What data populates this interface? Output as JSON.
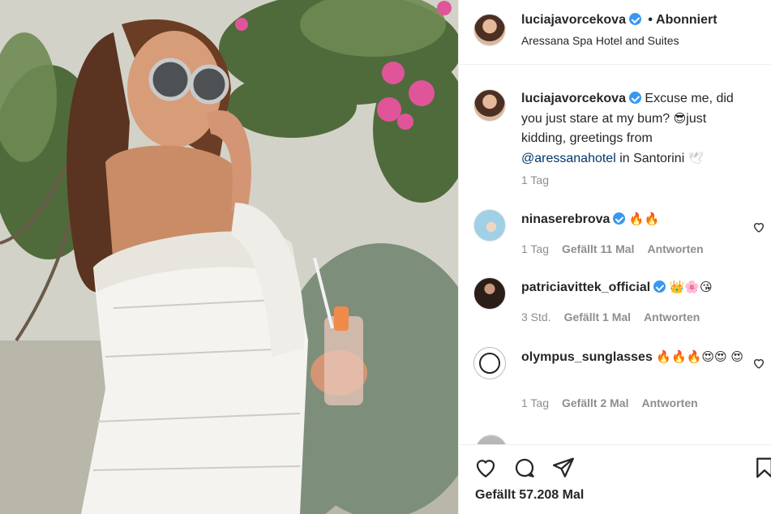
{
  "post": {
    "author": "luciajavorcekova",
    "follow_status": "Abonniert",
    "separator": "•",
    "location": "Aressana Spa Hotel and Suites",
    "caption": {
      "author": "luciajavorcekova",
      "text_before": "Excuse me, did you just stare at my bum? ",
      "emoji_1": "😎",
      "text_middle": "just kidding, greetings from ",
      "mention": "@aressanahotel",
      "text_after": " in Santorini ",
      "emoji_2": "🕊",
      "time": "1 Tag"
    },
    "likes": "Gefällt 57.208 Mal"
  },
  "comments": [
    {
      "user": "ninaserebrova",
      "verified": true,
      "text": "🔥🔥",
      "time": "1 Tag",
      "likes": "Gefällt 11 Mal",
      "reply": "Antworten"
    },
    {
      "user": "patriciavittek_official",
      "verified": true,
      "text": "👑🌸😘",
      "time": "3 Std.",
      "likes": "Gefällt 1 Mal",
      "reply": "Antworten"
    },
    {
      "user": "olympus_sunglasses",
      "verified": false,
      "text": "🔥🔥🔥😍😍 😍",
      "time": "1 Tag",
      "likes": "Gefällt 2 Mal",
      "reply": "Antworten"
    }
  ],
  "icons": {
    "like": "heart-icon",
    "comment": "comment-icon",
    "share": "share-icon",
    "save": "bookmark-icon",
    "comment_like": "heart-icon"
  },
  "colors": {
    "verified": "#3897f0",
    "mention": "#00376b",
    "meta": "#8e8e8e",
    "text": "#262626"
  }
}
